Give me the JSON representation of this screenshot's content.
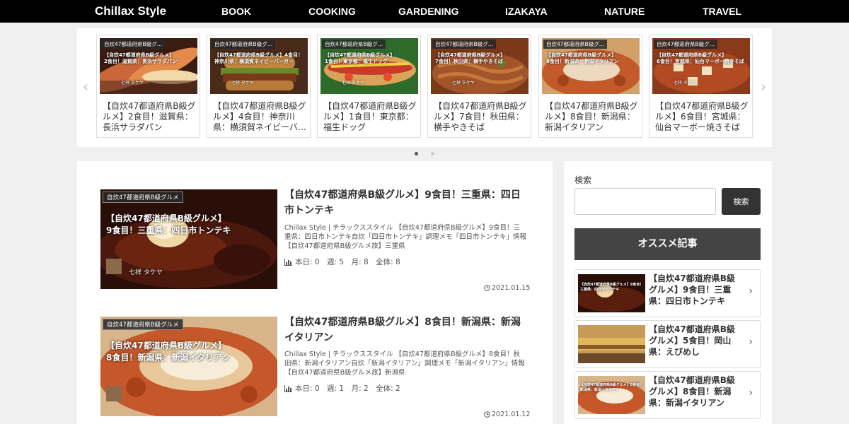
{
  "header": {
    "logo": "Chillax Style",
    "nav": [
      "BOOK",
      "COOKING",
      "GARDENING",
      "IZAKAYA",
      "NATURE",
      "TRAVEL"
    ]
  },
  "carousel": {
    "cards": [
      {
        "category": "自炊47都道府県B級グ…",
        "overlay1": "【自炊47都道府県B級グルメ】",
        "overlay2": "2食目！滋賀県：長浜サラダパン",
        "title": "【自炊47都道府県B級グルメ】2食目！滋賀県：長浜サラダパン"
      },
      {
        "category": "自炊47都道府県B級グ…",
        "overlay1": "【自炊47都道府県B級グルメ】4食目！",
        "overlay2": "神奈川県：横須賀ネイビーバーガー",
        "title": "【自炊47都道府県B級グルメ】4食目！神奈川県：横須賀ネイビーバ…"
      },
      {
        "category": "自炊47都道府県B級グ…",
        "overlay1": "【自炊47都道府県B級グルメ】",
        "overlay2": "1食目！東京都：福生ドッグ",
        "title": "【自炊47都道府県B級グルメ】1食目！東京都：福生ドッグ"
      },
      {
        "category": "自炊47都道府県B級グ…",
        "overlay1": "【自炊47都道府県B級グルメ】",
        "overlay2": "7食目！秋田県：横手やきそば",
        "title": "【自炊47都道府県B級グルメ】7食目！秋田県：横手やきそば"
      },
      {
        "category": "自炊47都道府県B級グ…",
        "overlay1": "【自炊47都道府県B級グルメ】",
        "overlay2": "8食目！新潟県：新潟イタリアン",
        "title": "【自炊47都道府県B級グルメ】8食目！新潟県：新潟イタリアン"
      },
      {
        "category": "自炊47都道府県B級グ…",
        "overlay1": "【自炊47都道府県B級グルメ】",
        "overlay2": "6食目！宮城県：仙台マーボー焼きそば",
        "title": "【自炊47都道府県B級グルメ】6食目！宮城県：仙台マーボー焼きそば"
      }
    ],
    "author_small": "七祥 タケヤ"
  },
  "posts": [
    {
      "category": "自炊47都道府県B級グルメ",
      "overlay1": "【自炊47都道府県B級グルメ】",
      "overlay2": "9食目！三重県：四日市トンテキ",
      "author": "七祥 タケヤ",
      "title": "【自炊47都道府県B級グルメ】9食目！三重県：四日市トンテキ",
      "excerpt": "Chillax Style | チラックススタイル 【自炊47都道府県B級グルメ】9食目！三重県：四日市トンテキ自炊「四日市トンテキ」調理メモ「四日市トンテキ」情報【自炊47都道府県B級グルメ旅】三重県",
      "stats": "本日: 0　週: 5　月: 8　全体: 8",
      "date": "2021.01.15"
    },
    {
      "category": "自炊47都道府県B級グルメ",
      "overlay1": "【自炊47都道府県B級グルメ】",
      "overlay2": "8食目！新潟県：新潟イタリアン",
      "author": "",
      "title": "【自炊47都道府県B級グルメ】8食目！新潟県：新潟イタリアン",
      "excerpt": "Chillax Style | チラックススタイル 【自炊47都道府県B級グルメ】8食目！秋田県：新潟イタリアン自炊「新潟イタリアン」調理メモ「新潟イタリアン」情報【自炊47都道府県B級グルメ旅】新潟県",
      "stats": "本日: 0　週: 1　月: 2　全体: 2",
      "date": "2021.01.12"
    }
  ],
  "sidebar": {
    "search_label": "検索",
    "search_placeholder": "",
    "search_button": "検索",
    "recommend_heading": "オススメ記事",
    "recommend": [
      {
        "title": "【自炊47都道府県B級グルメ】9食目！三重県：四日市トンテキ",
        "thumb_caption": "【自炊47都道府県B級グルメ】9食目！三重県：四日市トンテキ"
      },
      {
        "title": "【自炊47都道府県B級グルメ】5食目！岡山県：えびめし",
        "thumb_caption": ""
      },
      {
        "title": "【自炊47都道府県B級グルメ】8食目！新潟県：新潟イタリアン",
        "thumb_caption": "【自炊47都道府県B級グルメ】8食目！新潟県：新潟イタリアン"
      }
    ]
  },
  "icons": {
    "prev": "chevron-left-icon",
    "next": "chevron-right-icon",
    "chart": "bar-chart-icon",
    "clock": "clock-icon",
    "chevron": "chevron-right-icon"
  },
  "colors": {
    "header_bg": "#000000",
    "panel_bg": "#ffffff",
    "page_bg": "#f0f0f0",
    "heading_bg": "#444444",
    "dot_active": "#555555",
    "dot_inactive": "#cccccc"
  }
}
